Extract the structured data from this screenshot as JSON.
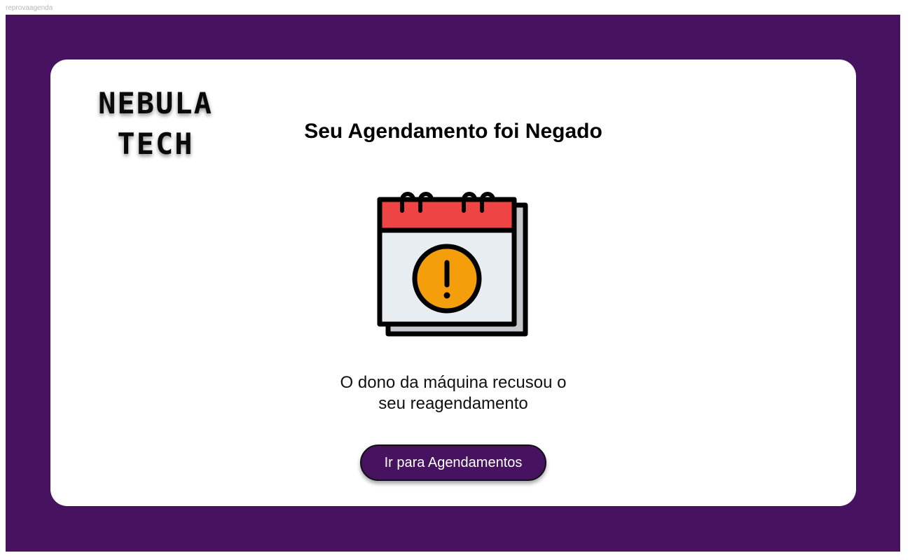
{
  "frame": {
    "label": "reprovaagenda"
  },
  "logo": {
    "line1": "NEBULA",
    "line2": "TECH"
  },
  "title": "Seu Agendamento foi Negado",
  "illustration": {
    "icon": "calendar-warning-icon"
  },
  "message": {
    "line1": "O dono da máquina recusou o",
    "line2": "seu reagendamento"
  },
  "button": {
    "label": "Ir para Agendamentos"
  },
  "colors": {
    "background": "#47125f",
    "card": "#ffffff",
    "button": "#47125f",
    "calendar_header": "#ef4444",
    "calendar_body": "#e8edf2",
    "warning": "#f59e0b"
  }
}
